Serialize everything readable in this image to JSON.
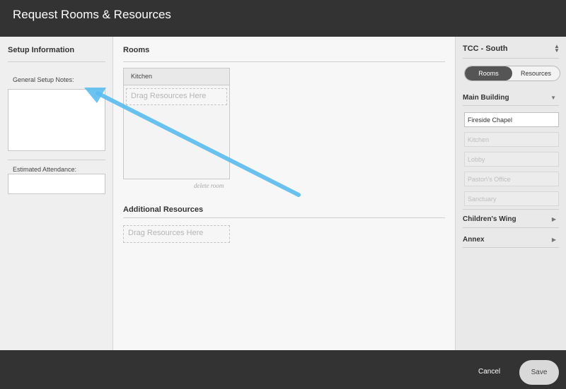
{
  "header": {
    "title": "Request Rooms & Resources"
  },
  "setup": {
    "title": "Setup Information",
    "notes_label": "General Setup Notes:",
    "notes_value": "",
    "attendance_label": "Estimated Attendance:",
    "attendance_value": ""
  },
  "rooms": {
    "title": "Rooms",
    "cards": [
      {
        "name": "Kitchen",
        "drop_text": "Drag Resources Here",
        "delete_label": "delete room"
      }
    ]
  },
  "additional": {
    "title": "Additional Resources",
    "drop_text": "Drag Resources Here"
  },
  "annotation": {
    "arrow_color": "#5bbcf0"
  },
  "sidebar": {
    "location": "TCC - South",
    "toggle": {
      "rooms_label": "Rooms",
      "resources_label": "Resources",
      "active": "rooms"
    },
    "groups": [
      {
        "name": "Main Building",
        "expanded": true,
        "rooms": [
          "Fireside Chapel",
          "Kitchen",
          "Lobby",
          "Pastor\\'s Office",
          "Sanctuary"
        ]
      },
      {
        "name": "Children's Wing",
        "expanded": false
      },
      {
        "name": "Annex",
        "expanded": false
      }
    ]
  },
  "footer": {
    "cancel_label": "Cancel",
    "save_label": "Save"
  },
  "colors": {
    "header_bg": "#333333",
    "footer_bg": "#333333",
    "toggle_active": "#555555"
  }
}
